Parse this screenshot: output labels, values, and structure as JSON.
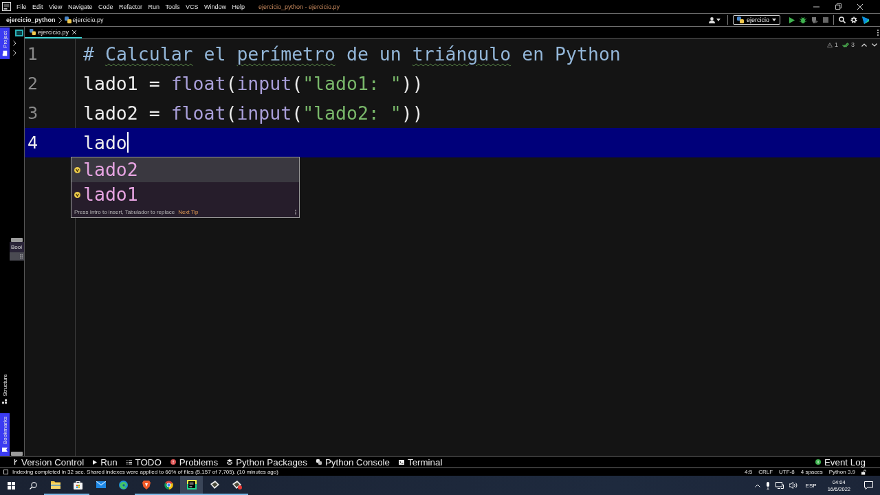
{
  "title_bar": {
    "menu": [
      "File",
      "Edit",
      "View",
      "Navigate",
      "Code",
      "Refactor",
      "Run",
      "Tools",
      "VCS",
      "Window",
      "Help"
    ],
    "title": "ejercicio_python - ejercicio.py"
  },
  "nav_bar": {
    "breadcrumb": [
      {
        "kind": "project",
        "label": "ejercicio_python"
      },
      {
        "kind": "file",
        "label": "ejercicio.py"
      }
    ],
    "run_config": "ejercicio"
  },
  "tool_stripe": {
    "top": [
      {
        "kind": "project",
        "label": "Project",
        "selected": true
      }
    ],
    "bottom": [
      {
        "kind": "structure",
        "label": "Structure",
        "selected": false
      },
      {
        "kind": "bookmarks",
        "label": "Bookmarks",
        "selected": true
      }
    ]
  },
  "project_panel": {
    "tooltip": "Bool"
  },
  "tabs": [
    {
      "label": "ejercicio.py",
      "selected": true
    }
  ],
  "inspections": [
    {
      "kind": "warning",
      "count": "1"
    },
    {
      "kind": "typo",
      "count": "3"
    }
  ],
  "editor": {
    "lines": [
      {
        "number": "1",
        "current": false,
        "tokens": [
          {
            "kind": "comment",
            "text": "# ",
            "typo": false
          },
          {
            "kind": "comment",
            "text": "Calcular",
            "typo": true
          },
          {
            "kind": "comment",
            "text": " el ",
            "typo": false
          },
          {
            "kind": "comment",
            "text": "perímetro",
            "typo": true
          },
          {
            "kind": "comment",
            "text": " de un ",
            "typo": false
          },
          {
            "kind": "comment",
            "text": "triángulo",
            "typo": true
          },
          {
            "kind": "comment",
            "text": " en Python",
            "typo": false
          }
        ]
      },
      {
        "number": "2",
        "current": false,
        "tokens": [
          {
            "kind": "plain",
            "text": "lado1 = ",
            "typo": false
          },
          {
            "kind": "builtin",
            "text": "float",
            "typo": false
          },
          {
            "kind": "plain",
            "text": "(",
            "typo": false
          },
          {
            "kind": "builtin",
            "text": "input",
            "typo": false
          },
          {
            "kind": "plain",
            "text": "(",
            "typo": false
          },
          {
            "kind": "string",
            "text": "\"lado1: \"",
            "typo": false
          },
          {
            "kind": "plain",
            "text": "))",
            "typo": false
          }
        ]
      },
      {
        "number": "3",
        "current": false,
        "tokens": [
          {
            "kind": "plain",
            "text": "lado2 = ",
            "typo": false
          },
          {
            "kind": "builtin",
            "text": "float",
            "typo": false
          },
          {
            "kind": "plain",
            "text": "(",
            "typo": false
          },
          {
            "kind": "builtin",
            "text": "input",
            "typo": false
          },
          {
            "kind": "plain",
            "text": "(",
            "typo": false
          },
          {
            "kind": "string",
            "text": "\"lado2: \"",
            "typo": false
          },
          {
            "kind": "plain",
            "text": "))",
            "typo": false
          }
        ]
      },
      {
        "number": "4",
        "current": true,
        "tokens": [
          {
            "kind": "plain",
            "text": "lado",
            "typo": false
          }
        ]
      }
    ]
  },
  "completion": {
    "items": [
      {
        "kind": "variable",
        "label": "lado2",
        "selected": true
      },
      {
        "kind": "variable",
        "label": "lado1",
        "selected": false
      }
    ],
    "hint": "Press Intro to insert, Tabulador to replace",
    "link": "Next Tip"
  },
  "tool_windows": [
    {
      "kind": "vcs",
      "label": "Version Control"
    },
    {
      "kind": "run",
      "label": "Run"
    },
    {
      "kind": "todo",
      "label": "TODO"
    },
    {
      "kind": "problems",
      "label": "Problems"
    },
    {
      "kind": "packages",
      "label": "Python Packages"
    },
    {
      "kind": "console",
      "label": "Python Console"
    },
    {
      "kind": "terminal",
      "label": "Terminal"
    }
  ],
  "event_log": "Event Log",
  "status_bar": {
    "message": "Indexing completed in 32 sec. Shared indexes were applied to 66% of files (5,157 of 7,705). (10 minutes ago)",
    "widgets": [
      "4:5",
      "CRLF",
      "UTF-8",
      "4 spaces",
      "Python 3.9"
    ]
  },
  "taskbar": {
    "apps": [
      {
        "kind": "explorer",
        "selected": false,
        "running": true
      },
      {
        "kind": "store",
        "selected": false,
        "running": true
      },
      {
        "kind": "mail",
        "selected": false,
        "running": false
      },
      {
        "kind": "edge",
        "selected": false,
        "running": false
      },
      {
        "kind": "brave",
        "selected": false,
        "running": true
      },
      {
        "kind": "chrome",
        "selected": false,
        "running": true
      },
      {
        "kind": "pycharm",
        "selected": true,
        "running": true
      },
      {
        "kind": "card",
        "selected": false,
        "running": true
      },
      {
        "kind": "cardbadge",
        "selected": false,
        "running": true
      }
    ],
    "language": "ESP",
    "time": "04:04",
    "date": "16/6/2022"
  }
}
